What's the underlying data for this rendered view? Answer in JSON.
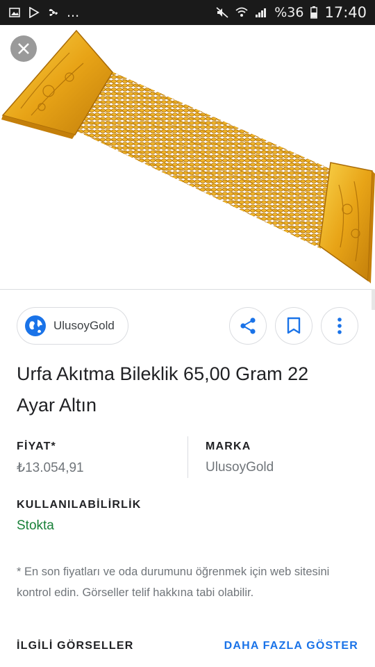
{
  "status_bar": {
    "left_icons": [
      "image-icon",
      "play-store-icon",
      "fan-icon"
    ],
    "ellipsis": "...",
    "right_icons": [
      "mute-icon",
      "wifi-icon",
      "signal-icon",
      "battery-icon"
    ],
    "battery_text": "%36",
    "time": "17:40"
  },
  "image": {
    "subject_icon": "gold-bracelet-image",
    "colors": {
      "gold": "#e8a417",
      "gold_light": "#f7cf4a",
      "gold_dark": "#b87508"
    }
  },
  "actions": {
    "source_label": "UlusoyGold",
    "source_icon": "globe-icon",
    "share_icon": "share-icon",
    "save_icon": "bookmark-icon",
    "more_icon": "more-vert-icon",
    "accent": "#1a73e8"
  },
  "product": {
    "title": "Urfa Akıtma Bileklik 65,00 Gram 22 Ayar Altın",
    "price_label": "FİYAT*",
    "price_value": "₺13.054,91",
    "brand_label": "MARKA",
    "brand_value": "UlusoyGold",
    "availability_label": "KULLANILABİLİRLİK",
    "availability_value": "Stokta",
    "availability_color": "#188038"
  },
  "note": "* En son fiyatları ve oda durumunu öğrenmek için web sitesini kontrol edin. Görseller telif hakkına tabi olabilir.",
  "related": {
    "title": "İLGİLİ GÖRSELLER",
    "show_more": "DAHA FAZLA GÖSTER"
  }
}
